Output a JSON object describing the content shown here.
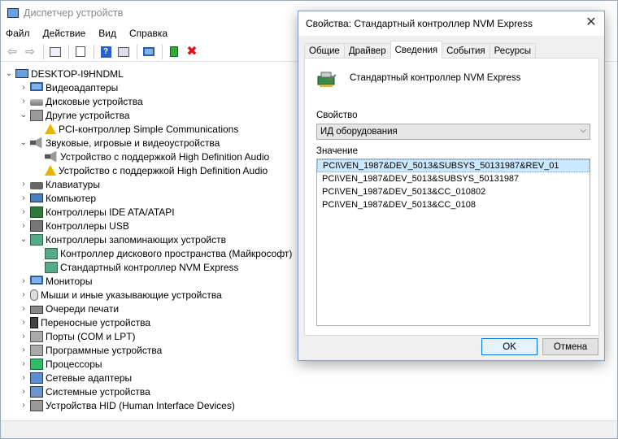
{
  "window": {
    "title": "Диспетчер устройств"
  },
  "menu": [
    "Файл",
    "Действие",
    "Вид",
    "Справка"
  ],
  "toolbar": {
    "icons": [
      "back-icon",
      "forward-icon",
      "properties-icon",
      "help-icon",
      "action-view-icon",
      "monitor-icon",
      "update-driver-icon",
      "uninstall-icon"
    ]
  },
  "tree": {
    "root": "DESKTOP-I9HNDML",
    "items": [
      {
        "label": "Видеоадаптеры",
        "icon": "display-adapter-icon",
        "level": 1,
        "expand": "collapsed"
      },
      {
        "label": "Дисковые устройства",
        "icon": "disk-drive-icon",
        "level": 1,
        "expand": "collapsed"
      },
      {
        "label": "Другие устройства",
        "icon": "other-devices-icon",
        "level": 1,
        "expand": "expanded"
      },
      {
        "label": "PCI-контроллер Simple Communications",
        "icon": "warning-icon",
        "level": 2,
        "expand": "none"
      },
      {
        "label": "Звуковые, игровые и видеоустройства",
        "icon": "speaker-icon",
        "level": 1,
        "expand": "expanded"
      },
      {
        "label": "Устройство с поддержкой High Definition Audio",
        "icon": "speaker-icon",
        "level": 2,
        "expand": "none"
      },
      {
        "label": "Устройство с поддержкой High Definition Audio",
        "icon": "speaker-warning-icon",
        "level": 2,
        "expand": "none"
      },
      {
        "label": "Клавиатуры",
        "icon": "keyboard-icon",
        "level": 1,
        "expand": "collapsed"
      },
      {
        "label": "Компьютер",
        "icon": "computer-icon",
        "level": 1,
        "expand": "collapsed"
      },
      {
        "label": "Контроллеры IDE ATA/ATAPI",
        "icon": "ide-controller-icon",
        "level": 1,
        "expand": "collapsed"
      },
      {
        "label": "Контроллеры USB",
        "icon": "usb-controller-icon",
        "level": 1,
        "expand": "collapsed"
      },
      {
        "label": "Контроллеры запоминающих устройств",
        "icon": "storage-controller-icon",
        "level": 1,
        "expand": "expanded"
      },
      {
        "label": "Контроллер дискового пространства (Майкрософт)",
        "icon": "storage-controller-icon",
        "level": 2,
        "expand": "none"
      },
      {
        "label": "Стандартный контроллер NVM Express",
        "icon": "storage-controller-icon",
        "level": 2,
        "expand": "none"
      },
      {
        "label": "Мониторы",
        "icon": "monitor-icon",
        "level": 1,
        "expand": "collapsed"
      },
      {
        "label": "Мыши и иные указывающие устройства",
        "icon": "mouse-icon",
        "level": 1,
        "expand": "collapsed"
      },
      {
        "label": "Очереди печати",
        "icon": "printer-icon",
        "level": 1,
        "expand": "collapsed"
      },
      {
        "label": "Переносные устройства",
        "icon": "portable-device-icon",
        "level": 1,
        "expand": "collapsed"
      },
      {
        "label": "Порты (COM и LPT)",
        "icon": "port-icon",
        "level": 1,
        "expand": "collapsed"
      },
      {
        "label": "Программные устройства",
        "icon": "software-device-icon",
        "level": 1,
        "expand": "collapsed"
      },
      {
        "label": "Процессоры",
        "icon": "processor-icon",
        "level": 1,
        "expand": "collapsed"
      },
      {
        "label": "Сетевые адаптеры",
        "icon": "network-adapter-icon",
        "level": 1,
        "expand": "collapsed"
      },
      {
        "label": "Системные устройства",
        "icon": "system-device-icon",
        "level": 1,
        "expand": "collapsed"
      },
      {
        "label": "Устройства HID (Human Interface Devices)",
        "icon": "hid-icon",
        "level": 1,
        "expand": "collapsed"
      }
    ]
  },
  "dialog": {
    "title": "Свойства: Стандартный контроллер NVM Express",
    "close_glyph": "✕",
    "tabs": [
      {
        "label": "Общие",
        "active": false
      },
      {
        "label": "Драйвер",
        "active": false
      },
      {
        "label": "Сведения",
        "active": true
      },
      {
        "label": "События",
        "active": false
      },
      {
        "label": "Ресурсы",
        "active": false
      }
    ],
    "device_name": "Стандартный контроллер NVM Express",
    "property_label": "Свойство",
    "property_value": "ИД оборудования",
    "value_label": "Значение",
    "values": [
      "PCI\\VEN_1987&DEV_5013&SUBSYS_50131987&REV_01",
      "PCI\\VEN_1987&DEV_5013&SUBSYS_50131987",
      "PCI\\VEN_1987&DEV_5013&CC_010802",
      "PCI\\VEN_1987&DEV_5013&CC_0108"
    ],
    "selected_value_index": 0,
    "ok_label": "OK",
    "cancel_label": "Отмена"
  },
  "colors": {
    "accent": "#0078d7",
    "selection": "#cce8ff",
    "warning": "#e8b400",
    "uninstall_red": "#d11"
  }
}
